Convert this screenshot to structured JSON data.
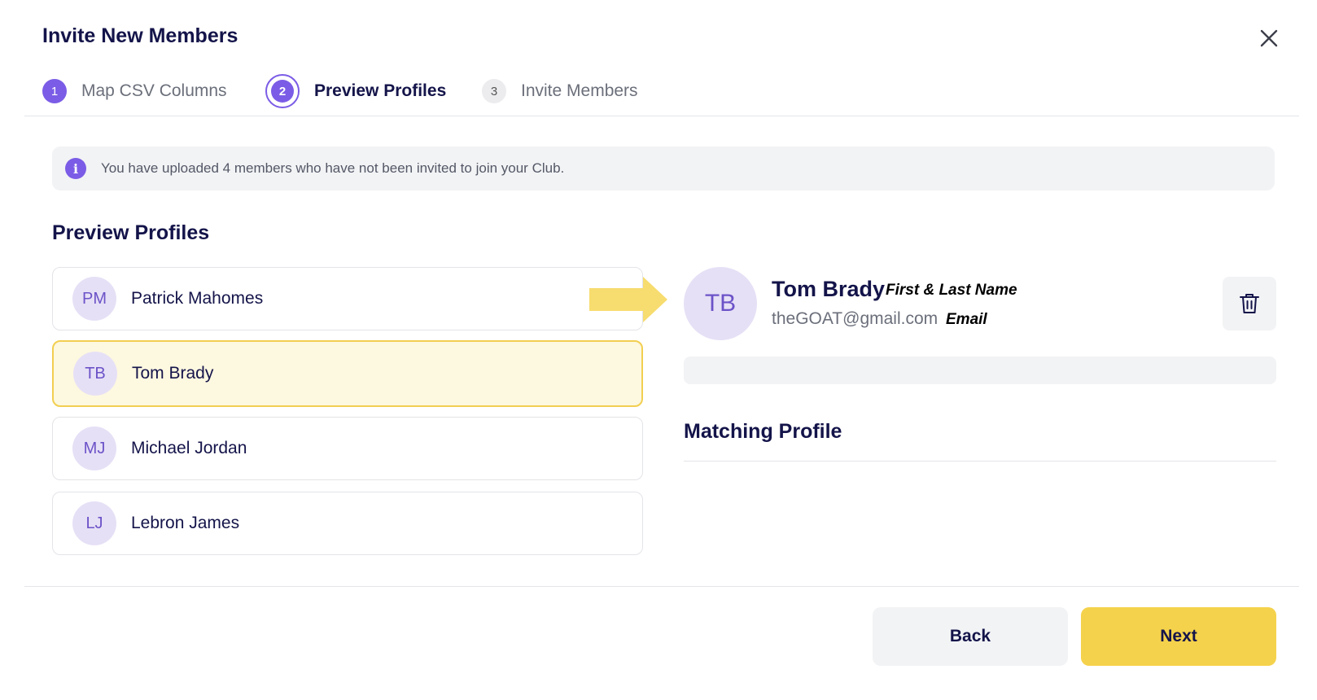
{
  "modal": {
    "title": "Invite New Members"
  },
  "stepper": {
    "steps": [
      {
        "number": "1",
        "label": "Map CSV Columns",
        "state": "done"
      },
      {
        "number": "2",
        "label": "Preview Profiles",
        "state": "active"
      },
      {
        "number": "3",
        "label": "Invite Members",
        "state": "future"
      }
    ]
  },
  "info_banner": {
    "icon": "info-icon",
    "text": "You have uploaded 4 members who have not been invited to join your Club."
  },
  "preview": {
    "title": "Preview Profiles",
    "profiles": [
      {
        "initials": "PM",
        "name": "Patrick Mahomes"
      },
      {
        "initials": "TB",
        "name": "Tom Brady"
      },
      {
        "initials": "MJ",
        "name": "Michael Jordan"
      },
      {
        "initials": "LJ",
        "name": "Lebron James"
      }
    ]
  },
  "detail": {
    "initials": "TB",
    "name": "Tom Brady",
    "name_annotation": "First & Last Name",
    "email": "theGOAT@gmail.com",
    "email_annotation": "Email",
    "matching_title": "Matching Profile"
  },
  "footer": {
    "back_label": "Back",
    "next_label": "Next"
  },
  "colors": {
    "accent": "#7b5ce6",
    "selected_bg": "#fdf8e0",
    "selected_border": "#f2cf51",
    "primary_button": "#f5d24c",
    "annotation_arrow": "#f7dc6f"
  }
}
